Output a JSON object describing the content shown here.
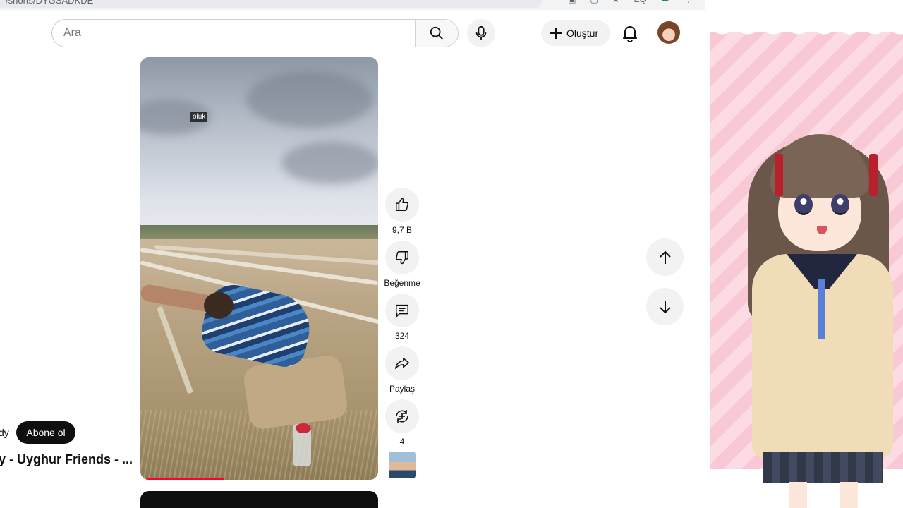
{
  "browser": {
    "url": "/shorts/DYGSADKDE",
    "toolbar_icons": [
      "translate-icon",
      "cast-icon",
      "star-icon",
      "eq-icon",
      "profile-dot",
      "more-icon"
    ],
    "eq_label": "EQ"
  },
  "header": {
    "search_placeholder": "Ara",
    "create_label": "Oluştur"
  },
  "video": {
    "caption_tag": "oluk",
    "progress": 0.33
  },
  "actions": {
    "like_count": "9,7 B",
    "dislike_label": "Beğenme",
    "comment_count": "324",
    "share_label": "Paylaş",
    "remix_count": "4"
  },
  "channel": {
    "name_partial": "dy",
    "subscribe_label": "Abone ol",
    "title_partial": "y - Uyghur Friends - ..."
  },
  "colors": {
    "accent": "#ff0033",
    "subscribe_bg": "#0f0f0f",
    "button_bg": "#f2f2f2"
  }
}
